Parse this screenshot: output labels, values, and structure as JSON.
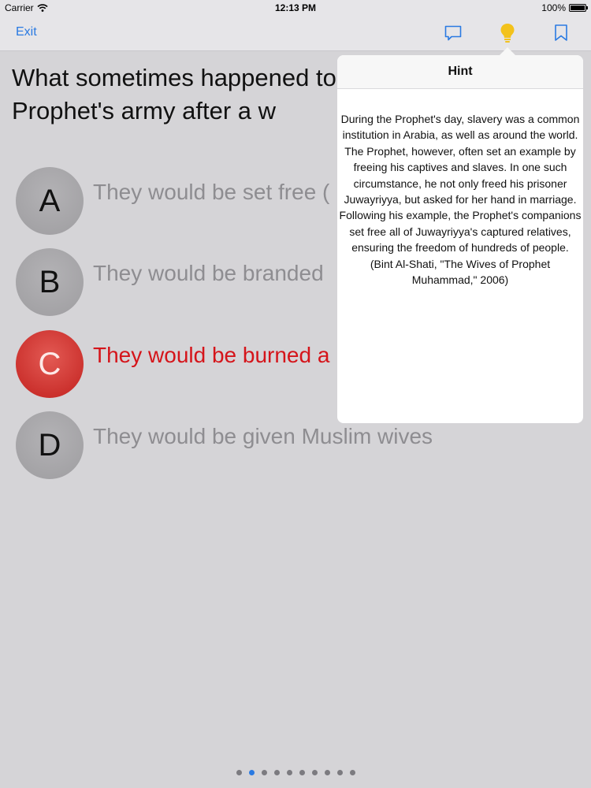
{
  "status_bar": {
    "carrier": "Carrier",
    "time": "12:13 PM",
    "battery": "100%"
  },
  "nav": {
    "exit_label": "Exit",
    "accent_color": "#2a7ae2",
    "hint_icon_color": "#f3c21b",
    "icons": [
      "comment-icon",
      "lightbulb-icon",
      "bookmark-icon"
    ]
  },
  "question": {
    "text": "What sometimes happened to the captives of the Prophet's army after a w"
  },
  "options": [
    {
      "letter": "A",
      "text": "They would be set free (",
      "selected": false
    },
    {
      "letter": "B",
      "text": "They would be branded",
      "selected": false
    },
    {
      "letter": "C",
      "text": "They would be burned a",
      "selected": true
    },
    {
      "letter": "D",
      "text": "They would be given Muslim wives",
      "selected": false
    }
  ],
  "hint": {
    "title": "Hint",
    "body": "During the Prophet's day, slavery was a common institution in Arabia, as well as around the world.  The Prophet, however, often set an example by freeing his captives and slaves.  In one such circumstance, he not only freed his prisoner Juwayriyya, but asked for her hand in marriage.  Following his example, the Prophet's companions set free all of Juwayriyya's captured relatives, ensuring the freedom of hundreds of people. (Bint Al-Shati, \"The Wives of Prophet Muhammad,\" 2006)"
  },
  "pagination": {
    "total": 10,
    "current": 2
  },
  "colors": {
    "selected_red": "#d5141a",
    "background": "#d5d4d7"
  }
}
